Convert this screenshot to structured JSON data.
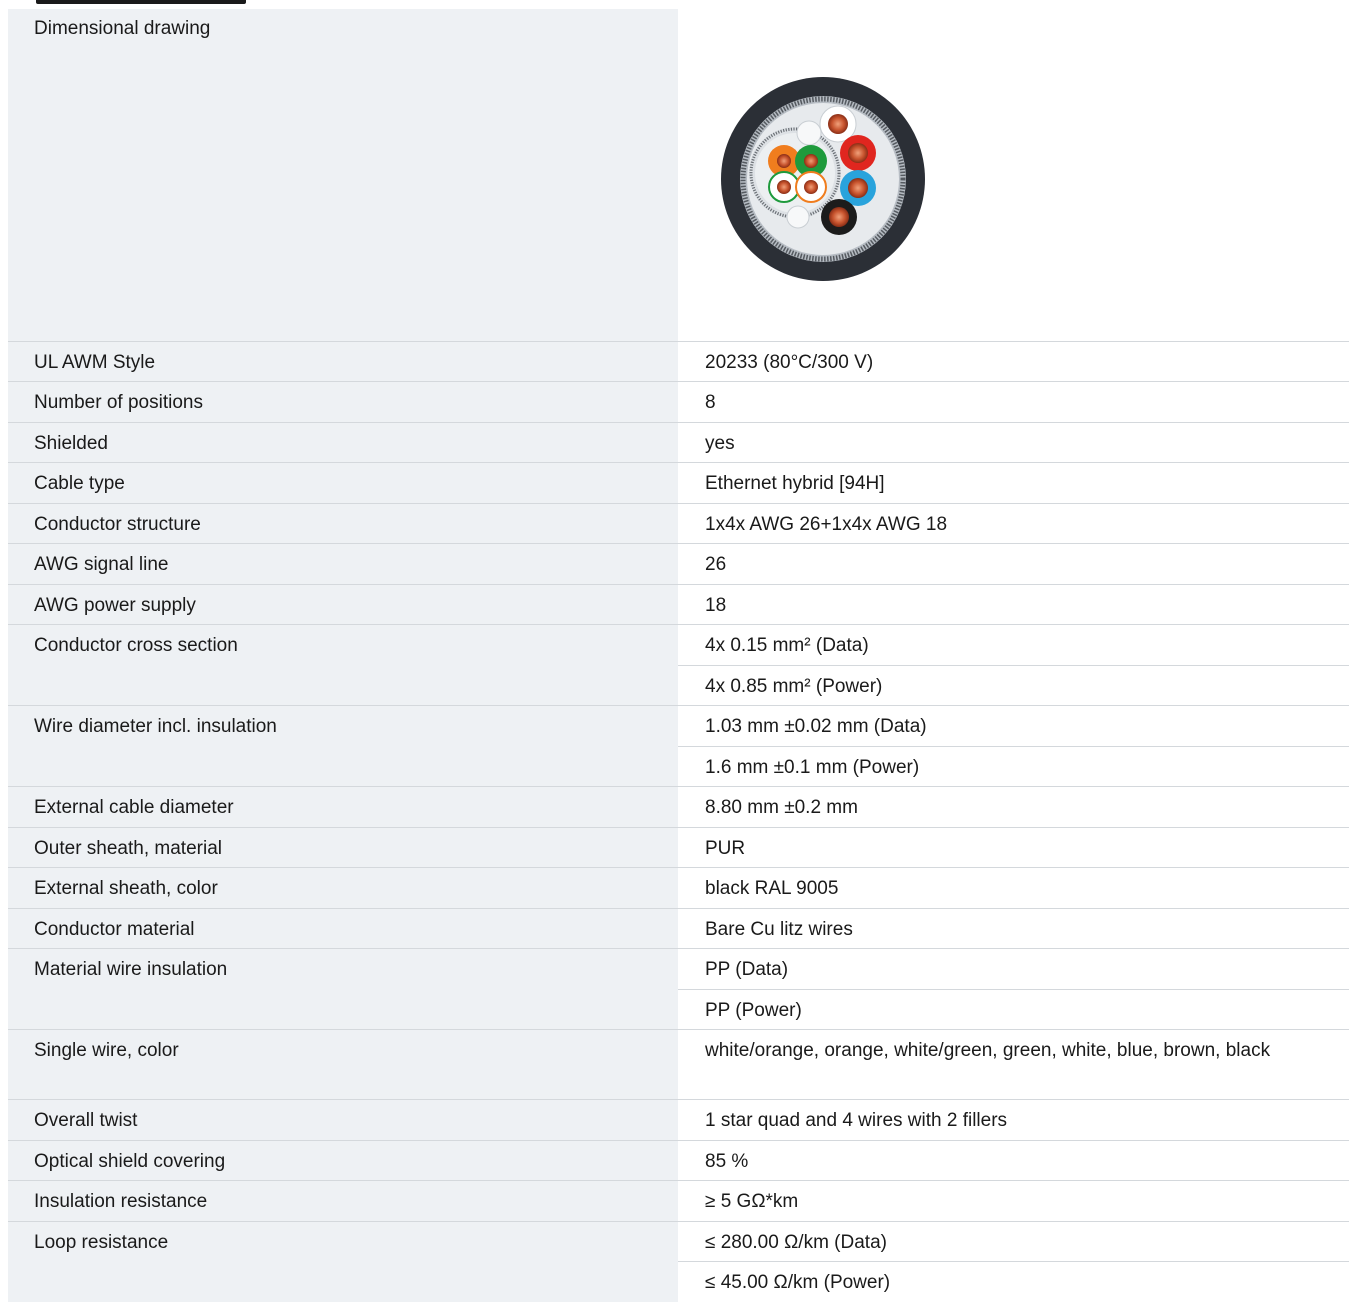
{
  "specs": [
    {
      "label": "Dimensional drawing",
      "values": []
    },
    {
      "label": "UL AWM Style",
      "values": [
        "20233 (80°C/300 V)"
      ]
    },
    {
      "label": "Number of positions",
      "values": [
        "8"
      ]
    },
    {
      "label": "Shielded",
      "values": [
        "yes"
      ]
    },
    {
      "label": "Cable type",
      "values": [
        "Ethernet hybrid [94H]"
      ]
    },
    {
      "label": "Conductor structure",
      "values": [
        "1x4x AWG 26+1x4x AWG 18"
      ]
    },
    {
      "label": "AWG signal line",
      "values": [
        "26"
      ]
    },
    {
      "label": "AWG power supply",
      "values": [
        "18"
      ]
    },
    {
      "label": "Conductor cross section",
      "values": [
        "4x 0.15 mm² (Data)",
        "4x 0.85 mm² (Power)"
      ]
    },
    {
      "label": "Wire diameter incl. insulation",
      "values": [
        "1.03 mm ±0.02 mm (Data)",
        "1.6 mm ±0.1 mm (Power)"
      ]
    },
    {
      "label": "External cable diameter",
      "values": [
        "8.80 mm ±0.2 mm"
      ]
    },
    {
      "label": "Outer sheath, material",
      "values": [
        "PUR"
      ]
    },
    {
      "label": "External sheath, color",
      "values": [
        "black RAL 9005"
      ]
    },
    {
      "label": "Conductor material",
      "values": [
        "Bare Cu litz wires"
      ]
    },
    {
      "label": "Material wire insulation",
      "values": [
        "PP (Data)",
        "PP (Power)"
      ]
    },
    {
      "label": "Single wire, color",
      "values": [
        "white/orange, orange, white/green, green, white, blue, brown, black"
      ]
    },
    {
      "label": "Overall twist",
      "values": [
        "1 star quad and 4 wires with 2 fillers"
      ]
    },
    {
      "label": "Optical shield covering",
      "values": [
        "85 %"
      ]
    },
    {
      "label": "Insulation resistance",
      "values": [
        "≥ 5 GΩ*km"
      ]
    },
    {
      "label": "Loop resistance",
      "values": [
        "≤ 280.00 Ω/km (Data)",
        "≤ 45.00 Ω/km (Power)"
      ]
    }
  ],
  "colors": {
    "label_bg": "#eef1f4",
    "border": "#d4d8dc",
    "text": "#1a1a1a",
    "sheath": "#2b2f36",
    "wire_orange": "#f07d1e",
    "wire_green": "#1e9a3c",
    "wire_red": "#e0261f",
    "wire_blue": "#29a3dc",
    "wire_black": "#1c1c1c"
  }
}
